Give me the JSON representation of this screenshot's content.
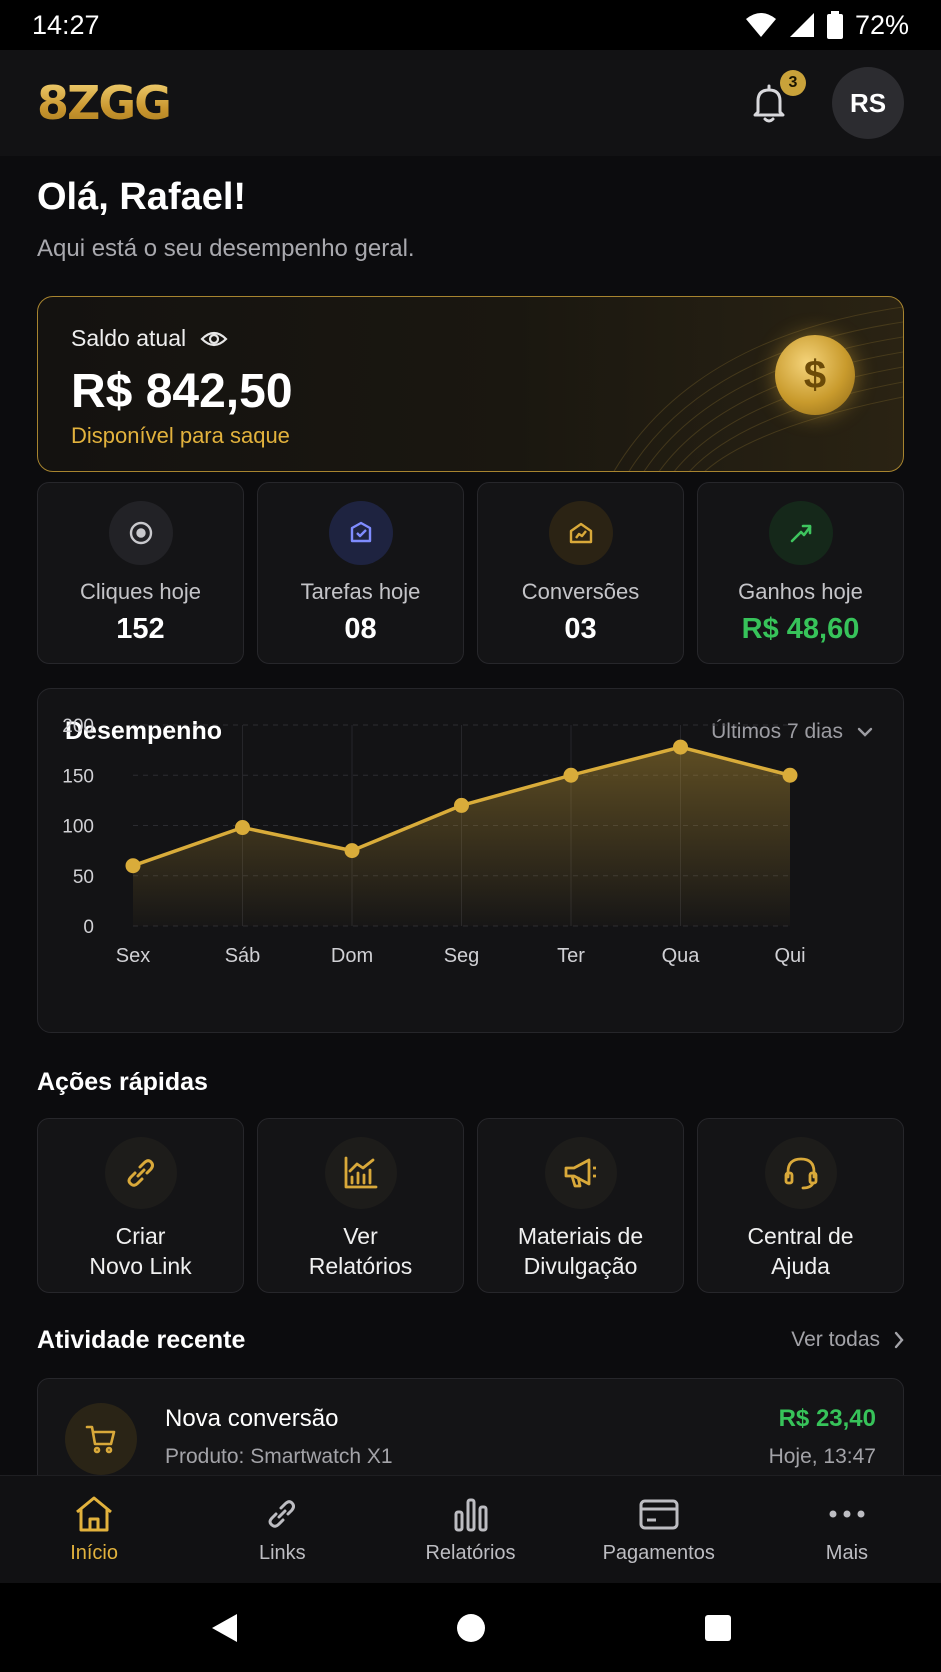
{
  "status_bar": {
    "time": "14:27",
    "battery": "72%"
  },
  "header": {
    "logo": "8ZGG",
    "notifications_count": "3",
    "avatar_initials": "RS"
  },
  "greeting": {
    "title": "Olá, Rafael!",
    "subtitle": "Aqui está o seu desempenho geral."
  },
  "balance": {
    "label": "Saldo atual",
    "value": "R$ 842,50",
    "sub": "Disponível para saque",
    "coin_symbol": "$"
  },
  "stats": [
    {
      "label": "Cliques hoje",
      "value": "152",
      "icon": "target-icon"
    },
    {
      "label": "Tarefas hoje",
      "value": "08",
      "icon": "task-check-icon"
    },
    {
      "label": "Conversões",
      "value": "03",
      "icon": "conversion-icon"
    },
    {
      "label": "Ganhos hoje",
      "value": "R$ 48,60",
      "icon": "growth-arrow-icon"
    }
  ],
  "chart": {
    "title": "Desempenho",
    "range_label": "Últimos 7 dias"
  },
  "chart_data": {
    "type": "area",
    "categories": [
      "Sex",
      "Sáb",
      "Dom",
      "Seg",
      "Ter",
      "Qua",
      "Qui"
    ],
    "values": [
      60,
      98,
      75,
      120,
      150,
      178,
      150
    ],
    "yticks": [
      "200",
      "150",
      "100",
      "50",
      "0"
    ],
    "ylim": [
      0,
      200
    ],
    "grid": true,
    "color": "#d9ac3a"
  },
  "quick_actions": {
    "title": "Ações rápidas",
    "items": [
      {
        "label": "Criar\nNovo Link",
        "icon": "link-icon"
      },
      {
        "label": "Ver\nRelatórios",
        "icon": "report-chart-icon"
      },
      {
        "label": "Materiais de\nDivulgação",
        "icon": "megaphone-icon"
      },
      {
        "label": "Central de\nAjuda",
        "icon": "headset-icon"
      }
    ]
  },
  "recent": {
    "title": "Atividade recente",
    "see_all": "Ver todas",
    "items": [
      {
        "title": "Nova conversão",
        "sub": "Produto: Smartwatch X1",
        "amount": "R$ 23,40",
        "time": "Hoje, 13:47",
        "icon": "cart-icon"
      }
    ]
  },
  "bottom_nav": [
    {
      "label": "Início",
      "icon": "home-icon",
      "active": true
    },
    {
      "label": "Links",
      "icon": "link-icon",
      "active": false
    },
    {
      "label": "Relatórios",
      "icon": "bar-chart-icon",
      "active": false
    },
    {
      "label": "Pagamentos",
      "icon": "card-icon",
      "active": false
    },
    {
      "label": "Mais",
      "icon": "more-dots-icon",
      "active": false
    }
  ],
  "colors": {
    "accent": "#e2b23d",
    "positive": "#37c35a",
    "background": "#0c0c0e"
  }
}
